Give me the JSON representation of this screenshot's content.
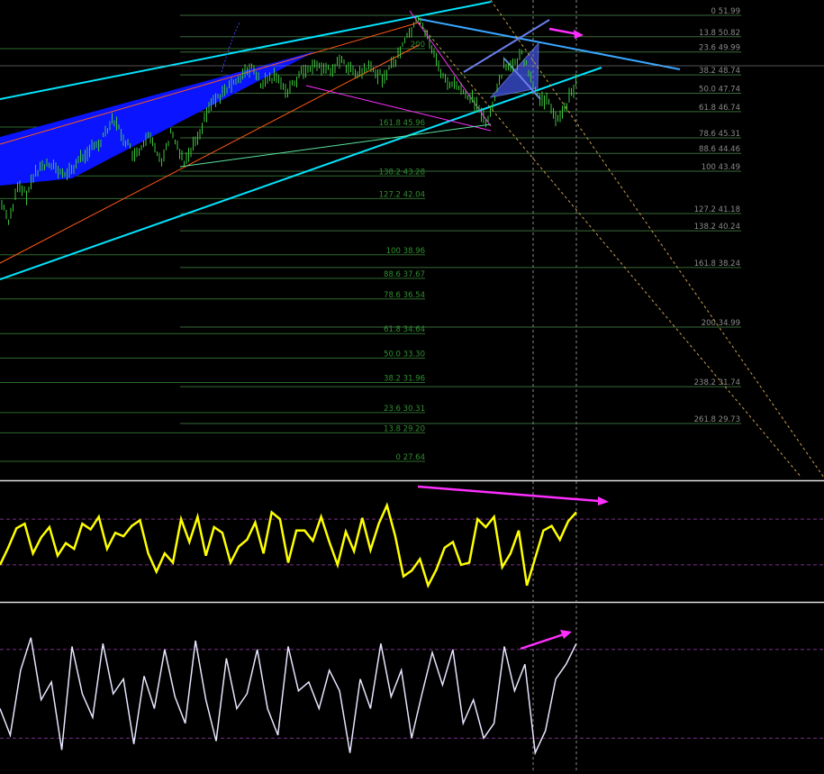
{
  "chart_data": [
    {
      "panel": "price",
      "type": "line",
      "fib_right": [
        {
          "label": "0 51.99",
          "level": 0,
          "value": 51.99
        },
        {
          "label": "13.8 50.82",
          "level": 13.8,
          "value": 50.82
        },
        {
          "label": "23.6 49.99",
          "level": 23.6,
          "value": 49.99
        },
        {
          "label": "38.2 48.74",
          "level": 38.2,
          "value": 48.74
        },
        {
          "label": "50.0 47.74",
          "level": 50.0,
          "value": 47.74
        },
        {
          "label": "61.8 46.74",
          "level": 61.8,
          "value": 46.74
        },
        {
          "label": "78.6 45.31",
          "level": 78.6,
          "value": 45.31
        },
        {
          "label": "88.6 44.46",
          "level": 88.6,
          "value": 44.46
        },
        {
          "label": "100 43.49",
          "level": 100,
          "value": 43.49
        },
        {
          "label": "127.2 41.18",
          "level": 127.2,
          "value": 41.18
        },
        {
          "label": "138.2 40.24",
          "level": 138.2,
          "value": 40.24
        },
        {
          "label": "161.8 38.24",
          "level": 161.8,
          "value": 38.24
        },
        {
          "label": "200 34.99",
          "level": 200,
          "value": 34.99
        },
        {
          "label": "238.2 31.74",
          "level": 238.2,
          "value": 31.74
        },
        {
          "label": "261.8 29.73",
          "level": 261.8,
          "value": 29.73
        }
      ],
      "fib_middle": [
        {
          "label": "200",
          "level": 200,
          "value": null
        },
        {
          "label": "161.8 45.96",
          "level": 161.8,
          "value": 45.96
        },
        {
          "label": "138.2 43.28",
          "level": 138.2,
          "value": 43.28
        },
        {
          "label": "127.2 42.04",
          "level": 127.2,
          "value": 42.04
        },
        {
          "label": "100 38.96",
          "level": 100,
          "value": 38.96
        },
        {
          "label": "88.6 37.67",
          "level": 88.6,
          "value": 37.67
        },
        {
          "label": "78.6 36.54",
          "level": 78.6,
          "value": 36.54
        },
        {
          "label": "61.8 34.64",
          "level": 61.8,
          "value": 34.64
        },
        {
          "label": "50.0 33.30",
          "level": 50.0,
          "value": 33.3
        },
        {
          "label": "38.2 31.96",
          "level": 38.2,
          "value": 31.96
        },
        {
          "label": "23.6 30.31",
          "level": 23.6,
          "value": 30.31
        },
        {
          "label": "13.8 29.20",
          "level": 13.8,
          "value": 29.2
        },
        {
          "label": "0 27.64",
          "level": 0,
          "value": 27.64
        }
      ],
      "price_path": [
        [
          0,
          41.9
        ],
        [
          10,
          40.8
        ],
        [
          20,
          42.6
        ],
        [
          30,
          42.2
        ],
        [
          40,
          43.5
        ],
        [
          55,
          44.0
        ],
        [
          70,
          43.2
        ],
        [
          80,
          43.6
        ],
        [
          95,
          44.5
        ],
        [
          110,
          45.0
        ],
        [
          125,
          46.4
        ],
        [
          135,
          45.5
        ],
        [
          150,
          44.2
        ],
        [
          165,
          45.3
        ],
        [
          180,
          44.1
        ],
        [
          190,
          45.6
        ],
        [
          205,
          44.0
        ],
        [
          215,
          45.0
        ],
        [
          225,
          46.0
        ],
        [
          235,
          47.3
        ],
        [
          250,
          47.8
        ],
        [
          265,
          48.6
        ],
        [
          280,
          49.1
        ],
        [
          290,
          48.2
        ],
        [
          305,
          48.6
        ],
        [
          320,
          47.9
        ],
        [
          335,
          48.9
        ],
        [
          350,
          49.3
        ],
        [
          365,
          49.0
        ],
        [
          380,
          49.5
        ],
        [
          395,
          48.7
        ],
        [
          410,
          49.1
        ],
        [
          425,
          48.6
        ],
        [
          440,
          49.6
        ],
        [
          455,
          51.1
        ],
        [
          465,
          51.8
        ],
        [
          475,
          50.9
        ],
        [
          485,
          49.4
        ],
        [
          495,
          48.4
        ],
        [
          510,
          48.0
        ],
        [
          525,
          47.4
        ],
        [
          540,
          46.2
        ],
        [
          550,
          47.5
        ],
        [
          560,
          49.4
        ],
        [
          570,
          49.1
        ],
        [
          580,
          49.9
        ],
        [
          590,
          48.4
        ],
        [
          600,
          47.4
        ],
        [
          610,
          47.2
        ],
        [
          620,
          46.2
        ],
        [
          630,
          47.2
        ],
        [
          640,
          48.4
        ]
      ],
      "colors": {
        "channel": "#00e5ff",
        "fill": "#0a14ff",
        "orange": "#ff5a14",
        "magenta": "#ff2fff",
        "bars": "#3cc43c"
      }
    },
    {
      "panel": "oscillator-1",
      "type": "line",
      "color": "#ffff00",
      "levels": [
        70,
        30
      ],
      "ylim": [
        0,
        100
      ],
      "values": [
        30,
        45,
        62,
        66,
        40,
        54,
        63,
        38,
        49,
        44,
        66,
        61,
        72,
        44,
        58,
        55,
        64,
        69,
        40,
        24,
        40,
        32,
        70,
        50,
        72,
        38,
        63,
        58,
        32,
        46,
        52,
        67,
        40,
        76,
        70,
        32,
        60,
        60,
        51,
        72,
        50,
        30,
        59,
        42,
        71,
        43,
        66,
        82,
        55,
        20,
        25,
        35,
        12,
        26,
        45,
        50,
        30,
        32,
        70,
        63,
        72,
        28,
        40,
        60,
        12,
        36,
        60,
        64,
        52,
        68,
        76
      ]
    },
    {
      "panel": "oscillator-2",
      "type": "line",
      "color": "#e6e6ff",
      "levels": [
        80,
        20
      ],
      "ylim": [
        0,
        100
      ],
      "values": [
        40,
        22,
        66,
        88,
        46,
        58,
        12,
        82,
        50,
        34,
        84,
        50,
        60,
        16,
        62,
        40,
        80,
        48,
        30,
        86,
        46,
        18,
        74,
        40,
        50,
        80,
        40,
        22,
        82,
        52,
        58,
        40,
        66,
        52,
        10,
        60,
        40,
        84,
        48,
        66,
        20,
        50,
        78,
        56,
        80,
        30,
        46,
        20,
        30,
        82,
        52,
        70,
        10,
        25,
        60,
        70,
        84
      ]
    }
  ]
}
